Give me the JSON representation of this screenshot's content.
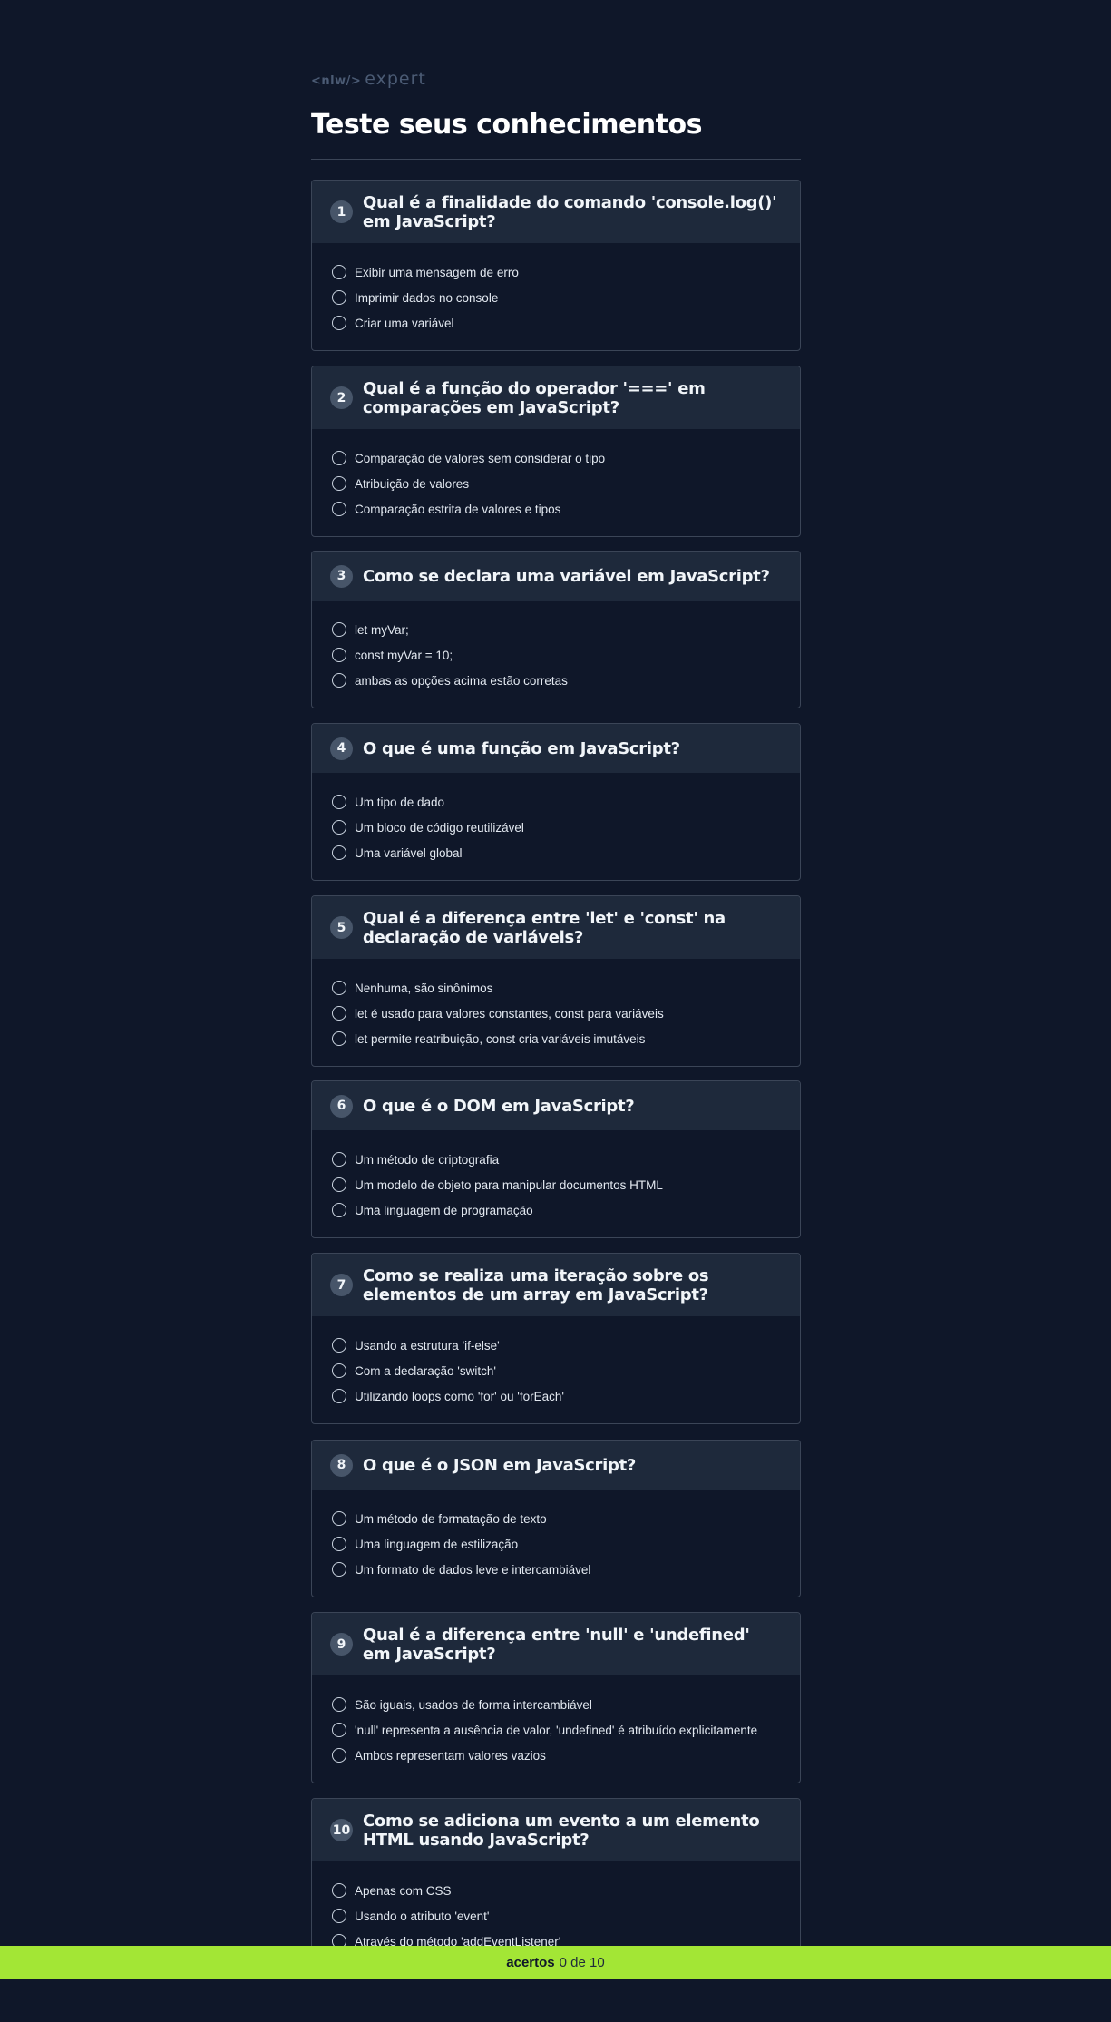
{
  "logo": {
    "tag": "<nlw/>",
    "word": "expert"
  },
  "title": "Teste seus conhecimentos",
  "questions": [
    {
      "number": "1",
      "text": "Qual é a finalidade do comando 'console.log()' em JavaScript?",
      "options": [
        "Exibir uma mensagem de erro",
        "Imprimir dados no console",
        "Criar uma variável"
      ]
    },
    {
      "number": "2",
      "text": "Qual é a função do operador '===' em comparações em JavaScript?",
      "options": [
        "Comparação de valores sem considerar o tipo",
        "Atribuição de valores",
        "Comparação estrita de valores e tipos"
      ]
    },
    {
      "number": "3",
      "text": "Como se declara uma variável em JavaScript?",
      "options": [
        "let myVar;",
        "const myVar = 10;",
        "ambas as opções acima estão corretas"
      ]
    },
    {
      "number": "4",
      "text": "O que é uma função em JavaScript?",
      "options": [
        "Um tipo de dado",
        "Um bloco de código reutilizável",
        "Uma variável global"
      ]
    },
    {
      "number": "5",
      "text": "Qual é a diferença entre 'let' e 'const' na declaração de variáveis?",
      "options": [
        "Nenhuma, são sinônimos",
        "let é usado para valores constantes, const para variáveis",
        "let permite reatribuição, const cria variáveis imutáveis"
      ]
    },
    {
      "number": "6",
      "text": "O que é o DOM em JavaScript?",
      "options": [
        "Um método de criptografia",
        "Um modelo de objeto para manipular documentos HTML",
        "Uma linguagem de programação"
      ]
    },
    {
      "number": "7",
      "text": "Como se realiza uma iteração sobre os elementos de um array em JavaScript?",
      "options": [
        "Usando a estrutura 'if-else'",
        "Com a declaração 'switch'",
        "Utilizando loops como 'for' ou 'forEach'"
      ]
    },
    {
      "number": "8",
      "text": "O que é o JSON em JavaScript?",
      "options": [
        "Um método de formatação de texto",
        "Uma linguagem de estilização",
        "Um formato de dados leve e intercambiável"
      ]
    },
    {
      "number": "9",
      "text": "Qual é a diferença entre 'null' e 'undefined' em JavaScript?",
      "options": [
        "São iguais, usados de forma intercambiável",
        "'null' representa a ausência de valor, 'undefined' é atribuído explicitamente",
        "Ambos representam valores vazios"
      ]
    },
    {
      "number": "10",
      "text": "Como se adiciona um evento a um elemento HTML usando JavaScript?",
      "options": [
        "Apenas com CSS",
        "Usando o atributo 'event'",
        "Através do método 'addEventListener'"
      ]
    }
  ],
  "footer": {
    "label": "acertos",
    "score": "0 de 10"
  }
}
